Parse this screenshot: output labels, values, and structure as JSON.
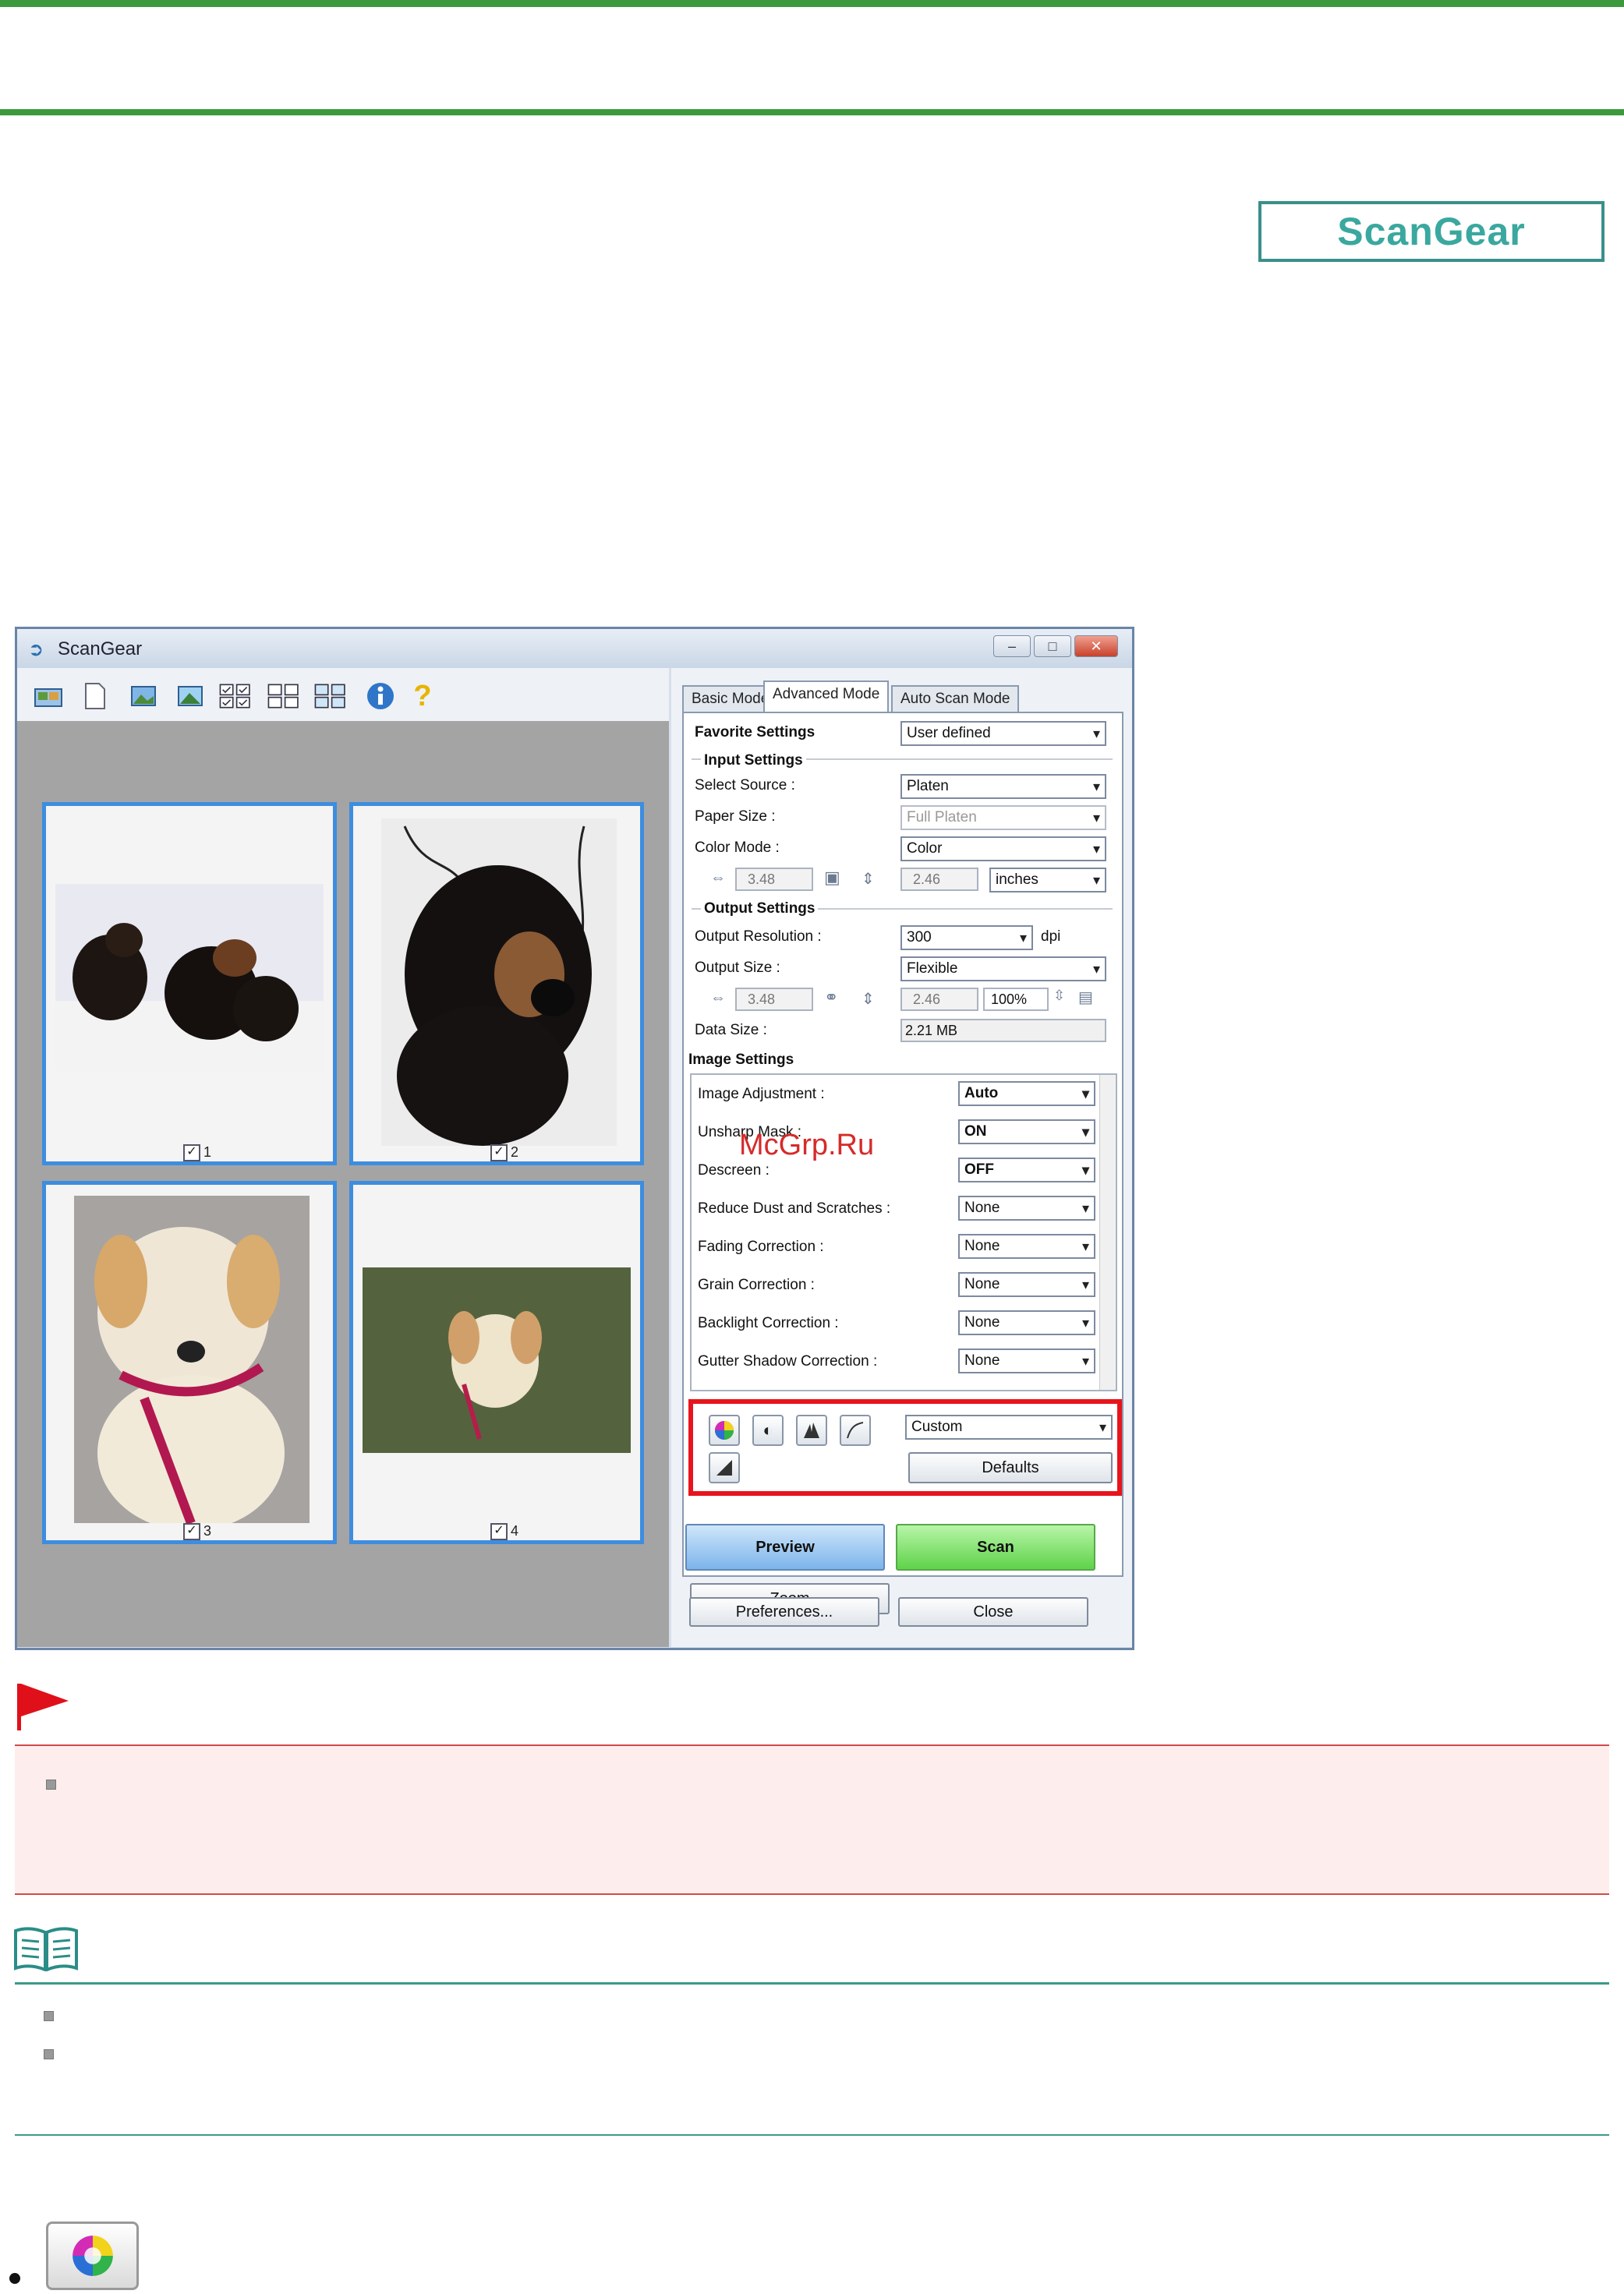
{
  "header": {
    "badge": "ScanGear"
  },
  "window": {
    "title": "ScanGear",
    "controls": {
      "minimize": "–",
      "maximize": "□",
      "close": "✕"
    },
    "toolbar_icons": [
      "scanner-icon",
      "document-icon",
      "crop-icon",
      "image-icon",
      "select-all-icon",
      "deselect-icon",
      "grid-icon",
      "info-icon",
      "help-icon"
    ],
    "thumbnails": [
      {
        "number": "1",
        "checked": true
      },
      {
        "number": "2",
        "checked": true
      },
      {
        "number": "3",
        "checked": true
      },
      {
        "number": "4",
        "checked": true
      }
    ],
    "tabs": [
      "Basic Mode",
      "Advanced Mode",
      "Auto Scan Mode"
    ],
    "active_tab": "Advanced Mode",
    "favorite": {
      "label": "Favorite Settings",
      "value": "User defined"
    },
    "input_settings": {
      "title": "Input Settings",
      "select_source": {
        "label": "Select Source :",
        "value": "Platen"
      },
      "paper_size": {
        "label": "Paper Size :",
        "value": "Full Platen"
      },
      "color_mode": {
        "label": "Color Mode :",
        "value": "Color"
      },
      "width": "3.48",
      "height": "2.46",
      "unit": "inches"
    },
    "output_settings": {
      "title": "Output Settings",
      "resolution": {
        "label": "Output Resolution :",
        "value": "300",
        "unit": "dpi"
      },
      "size": {
        "label": "Output Size :",
        "value": "Flexible"
      },
      "width": "3.48",
      "height": "2.46",
      "scale": "100%",
      "data_size": {
        "label": "Data Size :",
        "value": "2.21 MB"
      }
    },
    "image_settings": {
      "title": "Image Settings",
      "rows": [
        {
          "label": "Image Adjustment :",
          "value": "Auto"
        },
        {
          "label": "Unsharp Mask :",
          "value": "ON"
        },
        {
          "label": "Descreen :",
          "value": "OFF"
        },
        {
          "label": "Reduce Dust and Scratches :",
          "value": "None"
        },
        {
          "label": "Fading Correction :",
          "value": "None"
        },
        {
          "label": "Grain Correction :",
          "value": "None"
        },
        {
          "label": "Backlight Correction :",
          "value": "None"
        },
        {
          "label": "Gutter Shadow Correction :",
          "value": "None"
        }
      ]
    },
    "adjust": {
      "preset": "Custom",
      "defaults_label": "Defaults",
      "icons": [
        "color-adjust-icon",
        "brightness-contrast-icon",
        "histogram-icon",
        "tone-curve-icon",
        "threshold-icon"
      ]
    },
    "buttons": {
      "zoom": "Zoom",
      "preview": "Preview",
      "scan": "Scan",
      "preferences": "Preferences...",
      "close": "Close"
    }
  },
  "watermark": "McGrp.Ru",
  "colors": {
    "rule_green": "#3c9a3c",
    "highlight_red": "#e8141c",
    "thumb_border": "#3d8de0"
  }
}
